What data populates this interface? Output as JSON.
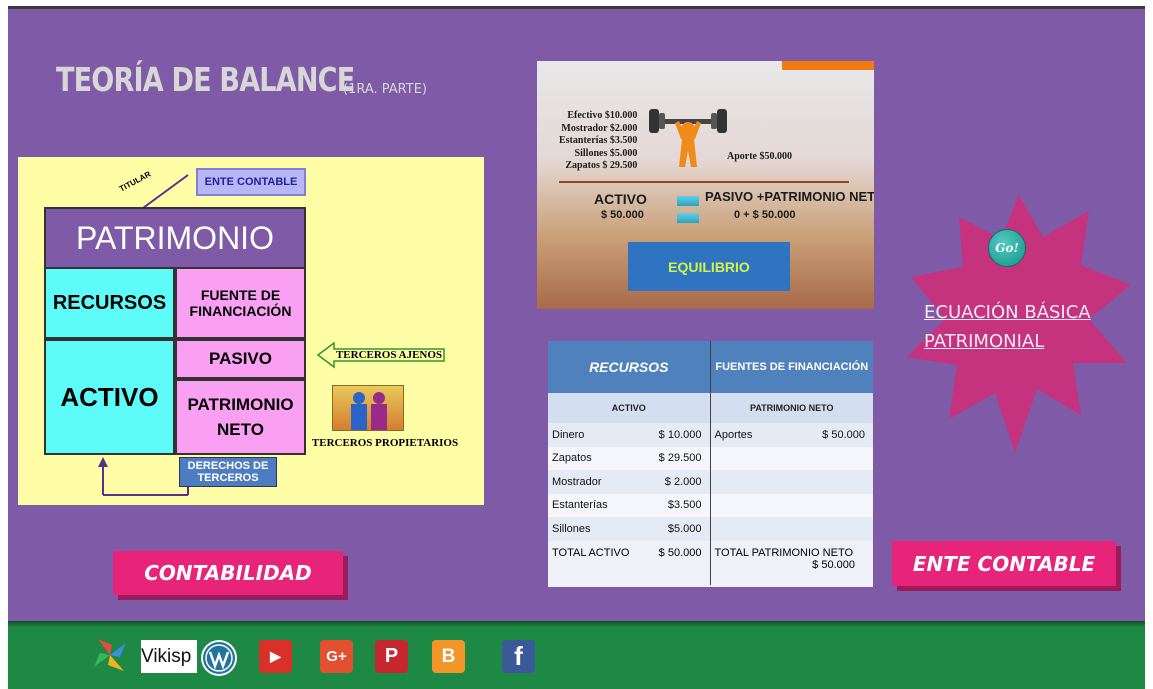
{
  "header": {
    "title": "TEORÍA DE BALANCE",
    "subtitle": "(1RA. PARTE)"
  },
  "diagram": {
    "titular": "TITULAR",
    "ente_contable": "ENTE CONTABLE",
    "patrimonio": "PATRIMONIO",
    "recursos": "RECURSOS",
    "fuente": "FUENTE DE FINANCIACIÓN",
    "activo": "ACTIVO",
    "pasivo": "PASIVO",
    "patrimonio_neto": "PATRIMONIO NETO",
    "derechos": "DERECHOS DE TERCEROS",
    "terceros_ajenos": "TERCEROS AJENOS",
    "terceros_propietarios": "TERCEROS PROPIETARIOS"
  },
  "equation_image": {
    "items": [
      "Efectivo $10.000",
      "Mostrador $2.000",
      "Estanterías $3.500",
      "Sillones $5.000",
      "Zapatos $ 29.500"
    ],
    "aporte": "Aporte $50.000",
    "activo": "ACTIVO",
    "pasivo": "PASIVO +PATRIMONIO NETO",
    "activo_value": "$ 50.000",
    "pasivo_values": "0 + $ 50.000",
    "button": "EQUILIBRIO"
  },
  "balance_table": {
    "header_left": "RECURSOS",
    "header_right": "FUENTES DE FINANCIACIÓN",
    "sub_left": "ACTIVO",
    "sub_right": "PATRIMONIO NETO",
    "rows": [
      {
        "label": "Dinero",
        "value": "$ 10.000",
        "r_label": "Aportes",
        "r_value": "$ 50.000"
      },
      {
        "label": "Zapatos",
        "value": "$ 29.500",
        "r_label": "",
        "r_value": ""
      },
      {
        "label": "Mostrador",
        "value": "$ 2.000",
        "r_label": "",
        "r_value": ""
      },
      {
        "label": "Estanterías",
        "value": "$3.500",
        "r_label": "",
        "r_value": ""
      },
      {
        "label": "Sillones",
        "value": "$5.000",
        "r_label": "",
        "r_value": ""
      }
    ],
    "total_left_label": "TOTAL ACTIVO",
    "total_left_value": "$ 50.000",
    "total_right_label": "TOTAL PATRIMONIO NETO",
    "total_right_value": "$ 50.000"
  },
  "star": {
    "go": "Go!",
    "link_line1": "ECUACIÓN BÁSICA",
    "link_line2": "PATRIMONIAL"
  },
  "buttons": {
    "contabilidad": "CONTABILIDAD",
    "ente_contable": "ENTE CONTABLE"
  },
  "footer": {
    "wiki_text": "Vikisp",
    "icons": [
      "site-logo-icon",
      "wikispaces-icon",
      "wordpress-icon",
      "youtube-icon",
      "google-plus-icon",
      "pinterest-icon",
      "blogger-icon",
      "facebook-icon"
    ],
    "youtube_glyph": "▶",
    "gplus_glyph": "G+",
    "pinterest_glyph": "P",
    "blogger_glyph": "B",
    "facebook_glyph": "f"
  },
  "colors": {
    "background": "#7f5aa6",
    "footer": "#1e8944",
    "pink_button": "#e8237a",
    "star": "#c5327e"
  }
}
